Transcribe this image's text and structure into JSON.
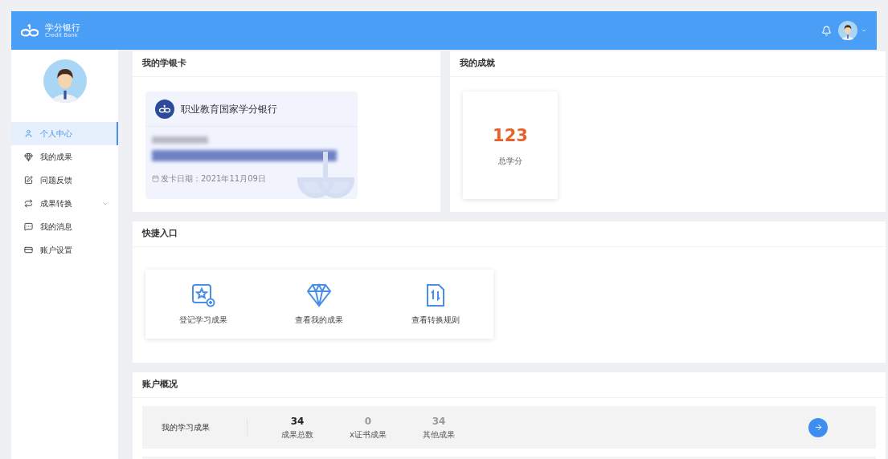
{
  "header": {
    "logo_title": "学分银行",
    "logo_subtitle": "Credit Bank"
  },
  "sidebar": {
    "items": [
      {
        "label": "个人中心",
        "selected": true,
        "kind": "user"
      },
      {
        "label": "我的成果",
        "selected": false,
        "kind": "diamond"
      },
      {
        "label": "问题反馈",
        "selected": false,
        "kind": "edit"
      },
      {
        "label": "成果转换",
        "selected": false,
        "kind": "convert",
        "expandable": true
      },
      {
        "label": "我的消息",
        "selected": false,
        "kind": "message"
      },
      {
        "label": "账户设置",
        "selected": false,
        "kind": "card"
      }
    ]
  },
  "card_panel": {
    "title": "我的学银卡",
    "bank_name": "职业教育国家学分银行",
    "issue_date": "发卡日期：2021年11月09日"
  },
  "achievement_panel": {
    "title": "我的成就",
    "total": "123",
    "total_label": "总学分"
  },
  "quick_panel": {
    "title": "快捷入口",
    "items": [
      {
        "label": "登记学习成果",
        "kind": "register"
      },
      {
        "label": "查看我的成果",
        "kind": "diamond"
      },
      {
        "label": "查看转换规则",
        "kind": "rules"
      }
    ]
  },
  "account_panel": {
    "title": "账户概况",
    "rows": [
      {
        "label": "我的学习成果",
        "stats": [
          {
            "value": "34",
            "label": "成果总数",
            "emphasis": true
          },
          {
            "value": "0",
            "label": "x证书成果",
            "emphasis": false
          },
          {
            "value": "34",
            "label": "其他成果",
            "emphasis": false
          }
        ]
      }
    ]
  }
}
